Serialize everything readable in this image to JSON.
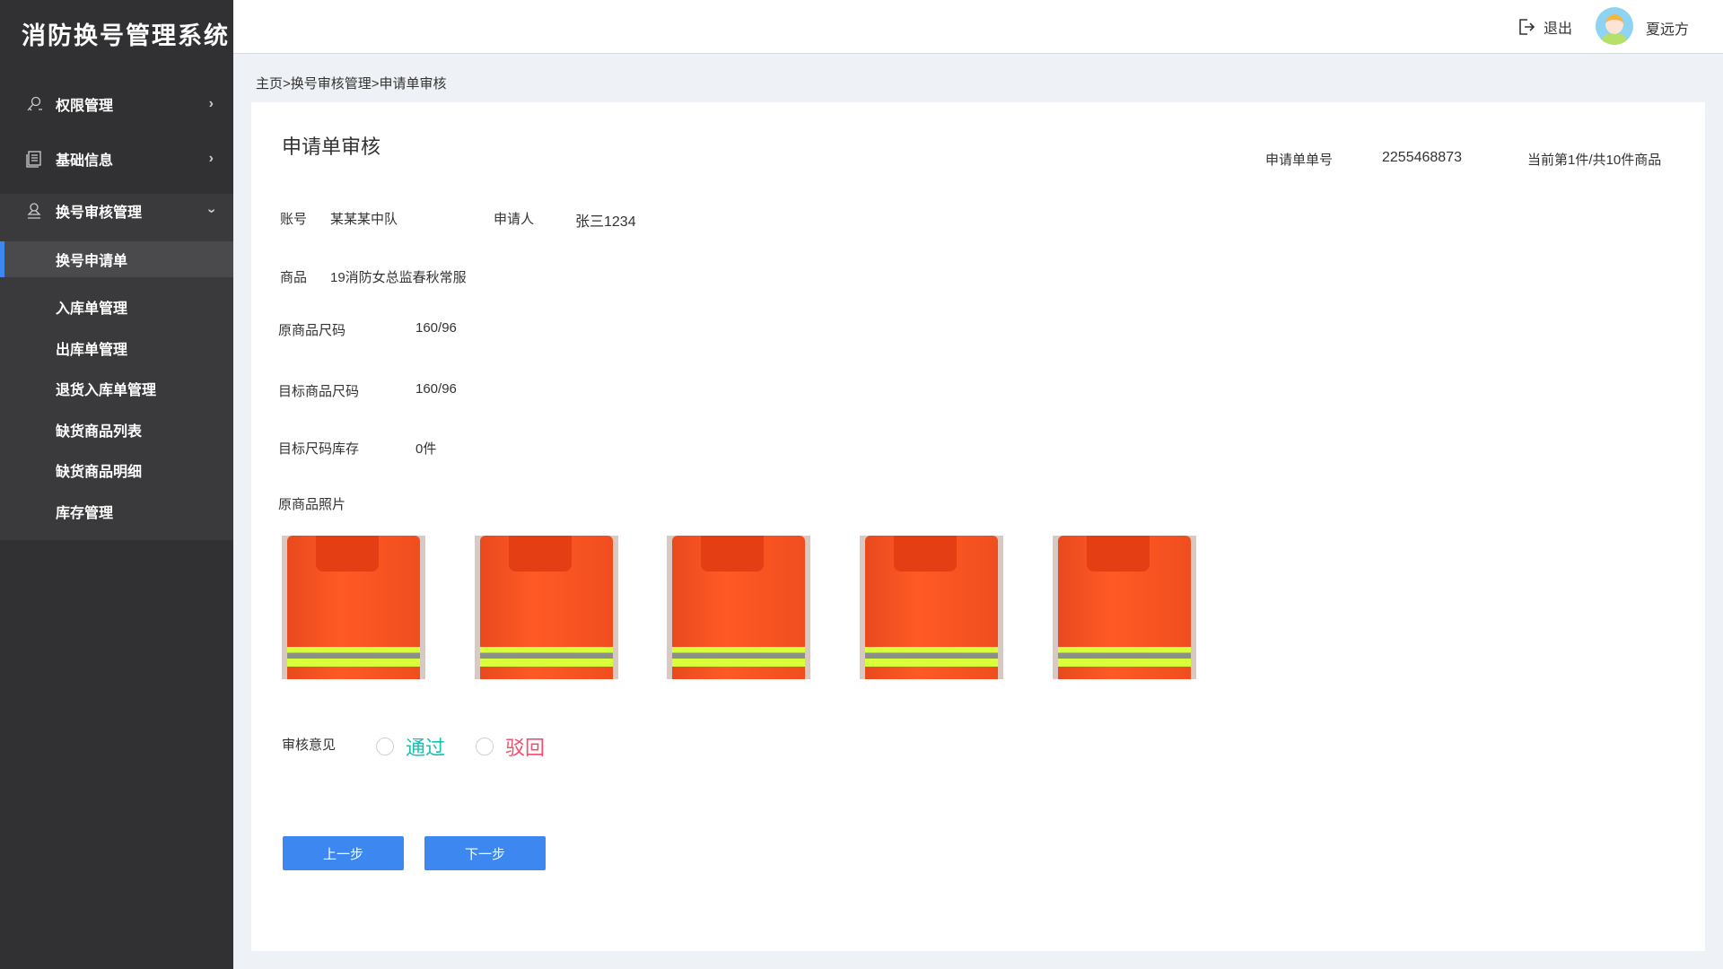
{
  "app": {
    "title": "消防换号管理系统"
  },
  "sidebar": {
    "items": [
      {
        "label": "权限管理",
        "icon": "key-icon"
      },
      {
        "label": "基础信息",
        "icon": "document-icon"
      },
      {
        "label": "换号审核管理",
        "icon": "stamp-icon",
        "expanded": true
      }
    ],
    "subitems": [
      {
        "label": "换号申请单",
        "active": true
      },
      {
        "label": "入库单管理"
      },
      {
        "label": "出库单管理"
      },
      {
        "label": "退货入库单管理"
      },
      {
        "label": "缺货商品列表"
      },
      {
        "label": "缺货商品明细"
      },
      {
        "label": "库存管理"
      }
    ]
  },
  "header": {
    "logout": "退出",
    "username": "夏远方"
  },
  "breadcrumb": "主页>换号审核管理>申请单审核",
  "main": {
    "title": "申请单审核",
    "order_no_label": "申请单单号",
    "order_no": "2255468873",
    "progress": "当前第1件/共10件商品",
    "account_label": "账号",
    "account": "某某某中队",
    "applicant_label": "申请人",
    "applicant": "张三1234",
    "product_label": "商品",
    "product": "19消防女总监春秋常服",
    "orig_size_label": "原商品尺码",
    "orig_size": "160/96",
    "target_size_label": "目标商品尺码",
    "target_size": "160/96",
    "stock_label": "目标尺码库存",
    "stock": "0件",
    "photos_label": "原商品照片",
    "photo_count": 5,
    "review_label": "审核意见",
    "approve": "通过",
    "reject": "驳回",
    "prev": "上一步",
    "next": "下一步"
  },
  "colors": {
    "accent": "#3d87f0",
    "approve": "#13c2b0",
    "reject": "#f0506e",
    "sidebar": "#313133"
  }
}
